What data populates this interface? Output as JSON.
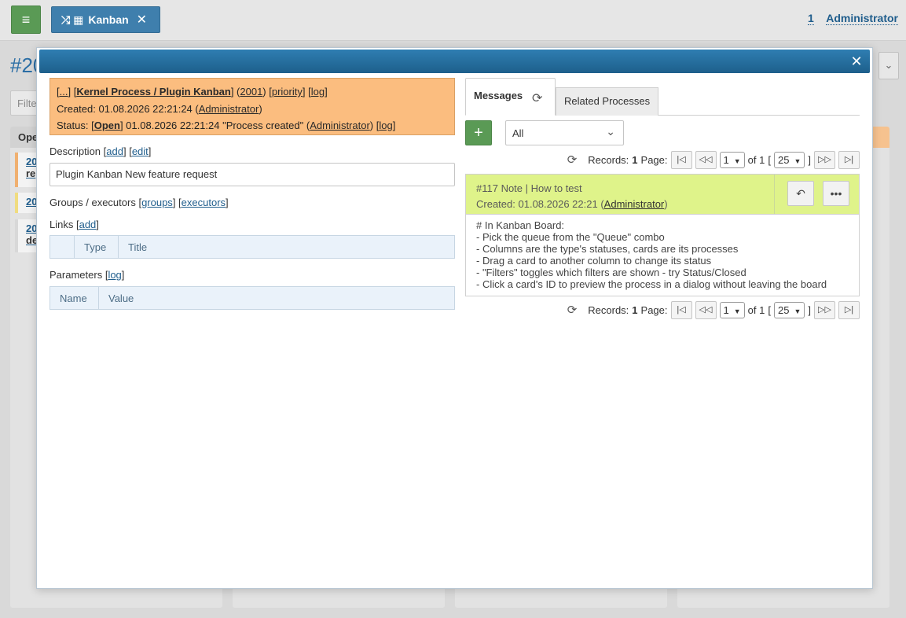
{
  "topbar": {
    "menu_icon": "≡",
    "tab_label": "Kanban",
    "tab_icons": "⤮ ▦",
    "tab_close": "✕",
    "user_count": "1",
    "user_name": "Administrator"
  },
  "background": {
    "title": "#20",
    "filter_placeholder": "Filter",
    "column_first": "Ope",
    "cards": [
      "20",
      "re",
      "20",
      "20",
      "de"
    ]
  },
  "dialog": {
    "close_icon": "✕",
    "process": {
      "ellipsis": "...",
      "type_path": "Kernel Process / Plugin Kanban",
      "id": "2001",
      "priority_label": "priority",
      "log_label": "log",
      "created_label": "Created:",
      "created_time": "01.08.2026 22:21:24",
      "created_user": "Administrator",
      "status_label": "Status:",
      "status_value": "Open",
      "status_time": "01.08.2026 22:21:24",
      "status_comment": "\"Process created\"",
      "status_user": "Administrator",
      "status_log": "log"
    },
    "description": {
      "label": "Description",
      "add": "add",
      "edit": "edit",
      "value": "Plugin Kanban New feature request"
    },
    "groups": {
      "label": "Groups / executors",
      "groups_link": "groups",
      "executors_link": "executors"
    },
    "links": {
      "label": "Links",
      "add": "add",
      "columns": [
        "",
        "Type",
        "Title"
      ]
    },
    "parameters": {
      "label": "Parameters",
      "log": "log",
      "columns": [
        "Name",
        "Value"
      ]
    },
    "tabs": {
      "messages": "Messages",
      "related": "Related Processes"
    },
    "messages": {
      "add_icon": "+",
      "filter_value": "All",
      "pager": {
        "records_label": "Records:",
        "records_count": "1",
        "page_label": "Page:",
        "page_value": "1",
        "of_label": "of 1",
        "page_size": "25"
      },
      "item": {
        "title": "#117 Note | How to test",
        "created_label": "Created:",
        "created_time": "01.08.2026 22:21",
        "author": "Administrator",
        "body": "# In Kanban Board:\n- Pick the queue from the \"Queue\" combo\n- Columns are the type's statuses, cards are its processes\n- Drag a card to another column to change its status\n- \"Filters\" toggles which filters are shown - try Status/Closed\n- Click a card's ID to preview the process in a dialog without leaving the board"
      }
    }
  }
}
